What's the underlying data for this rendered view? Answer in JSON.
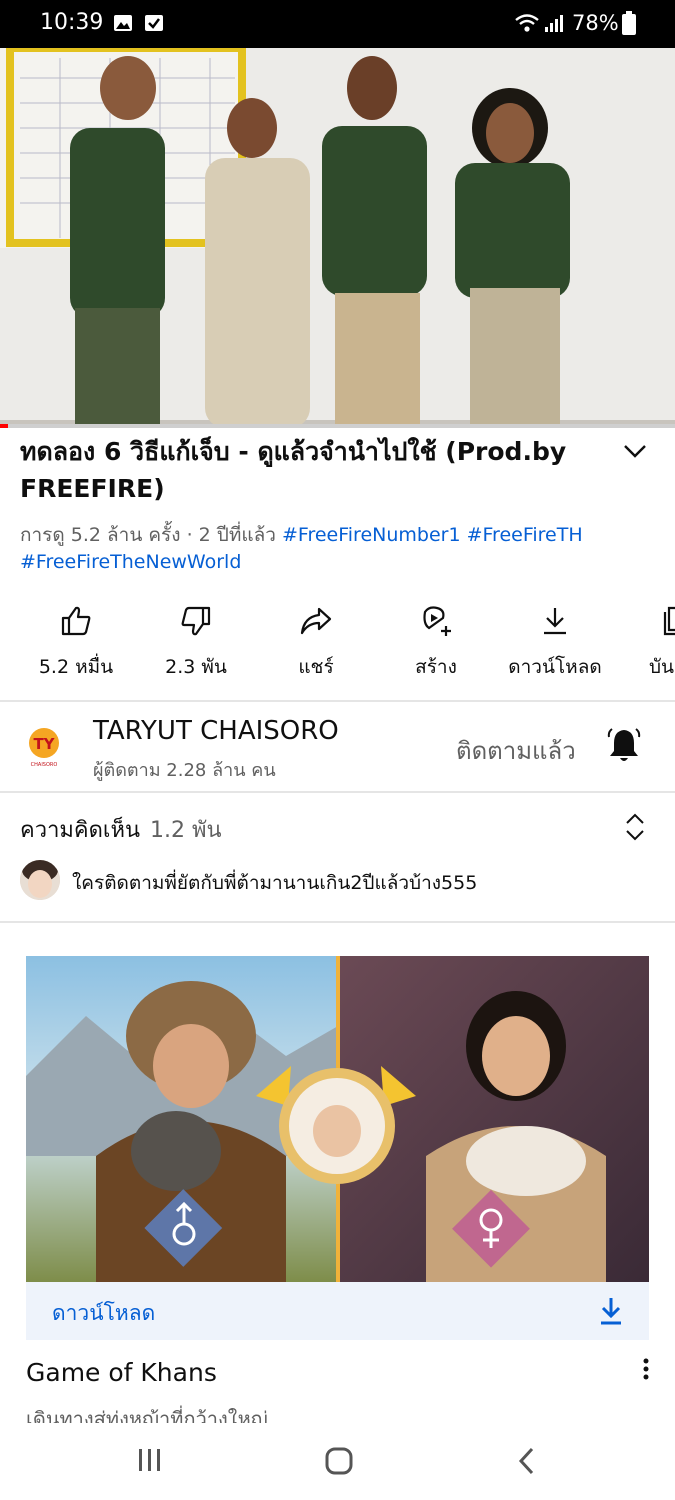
{
  "status_bar": {
    "time": "10:39",
    "battery": "78%"
  },
  "video": {
    "title": "ทดลอง 6 วิธีแก้เจ็บ - ดูแล้วจำนำไปใช้ (Prod.by FREEFIRE)",
    "meta": "การดู 5.2 ล้าน ครั้ง · 2 ปีที่แล้ว",
    "hashtags": [
      "#FreeFireNumber1",
      "#FreeFireTH",
      "#FreeFireTheNewWorld"
    ]
  },
  "actions": [
    {
      "icon": "thumbs-up-icon",
      "label": "5.2 หมื่น"
    },
    {
      "icon": "thumbs-down-icon",
      "label": "2.3 พัน"
    },
    {
      "icon": "share-icon",
      "label": "แชร์"
    },
    {
      "icon": "create-icon",
      "label": "สร้าง"
    },
    {
      "icon": "download-icon",
      "label": "ดาวน์โหลด"
    },
    {
      "icon": "save-icon",
      "label": "บัน"
    }
  ],
  "channel": {
    "logo_text": "TY",
    "logo_sub": "CHAISORO",
    "name": "TARYUT CHAISORO",
    "subscribers": "ผู้ติดตาม 2.28 ล้าน คน",
    "subscribe_state": "ติดตามแล้ว"
  },
  "comments": {
    "heading": "ความคิดเห็น",
    "count": "1.2 พัน",
    "top_comment": "ใครติดตามพี่ยัตกับพี่ต้ามานานเกิน2ปีแล้วบ้าง555"
  },
  "ad": {
    "download_label": "ดาวน์โหลด",
    "title": "Game of Khans",
    "subtitle": "เดินทางสู่ทุ่งหญ้าที่กว้างใหญ่"
  },
  "colors": {
    "accent": "#065fd4",
    "progress": "#ff0000",
    "logo": "#f5a623"
  }
}
